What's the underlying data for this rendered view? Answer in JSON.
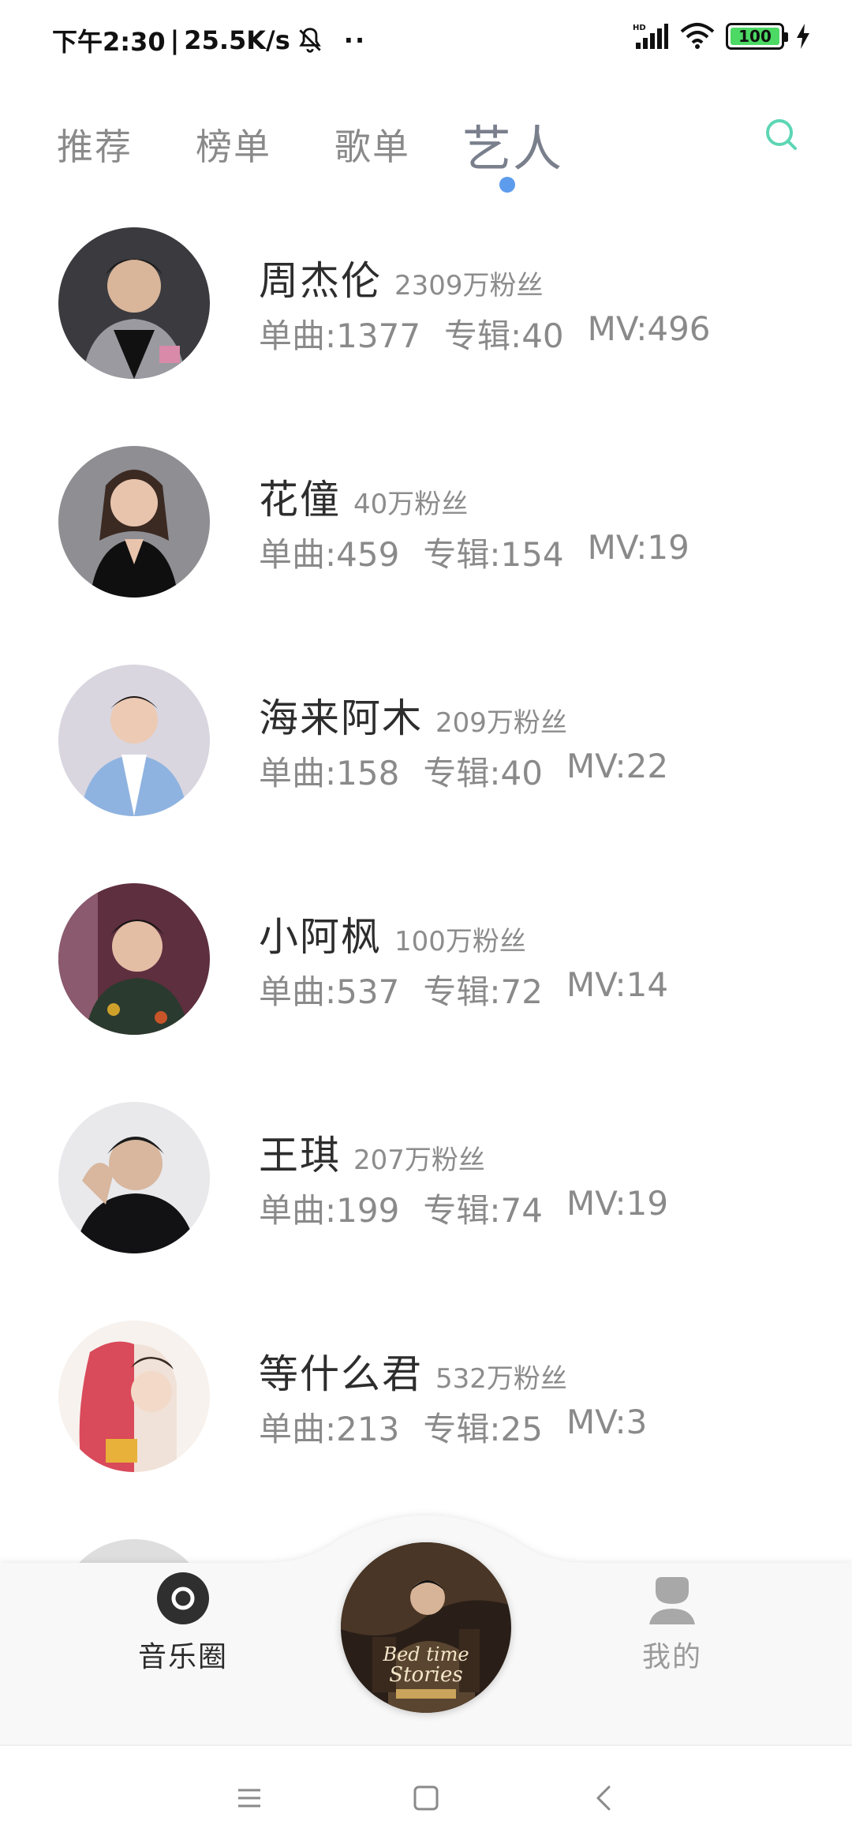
{
  "status_bar": {
    "time": "下午2:30",
    "network_speed": "25.5K/s",
    "separator": "|",
    "dots": "··",
    "hd_label": "HD",
    "battery_level": "100",
    "battery_color": "#4cd964"
  },
  "tabs": {
    "items": [
      {
        "label": "推荐"
      },
      {
        "label": "榜单"
      },
      {
        "label": "歌单"
      },
      {
        "label": "艺人"
      }
    ],
    "active_index": 3,
    "active_color": "#7a7f8c",
    "indicator_color": "#5d9cec",
    "search_icon": "search-icon",
    "search_color": "#5cd6b4"
  },
  "artists": [
    {
      "name": "周杰伦",
      "fans": "2309万粉丝",
      "songs": "单曲:1377",
      "albums": "专辑:40",
      "mvs": "MV:496"
    },
    {
      "name": "花僮",
      "fans": "40万粉丝",
      "songs": "单曲:459",
      "albums": "专辑:154",
      "mvs": "MV:19"
    },
    {
      "name": "海来阿木",
      "fans": "209万粉丝",
      "songs": "单曲:158",
      "albums": "专辑:40",
      "mvs": "MV:22"
    },
    {
      "name": "小阿枫",
      "fans": "100万粉丝",
      "songs": "单曲:537",
      "albums": "专辑:72",
      "mvs": "MV:14"
    },
    {
      "name": "王琪",
      "fans": "207万粉丝",
      "songs": "单曲:199",
      "albums": "专辑:74",
      "mvs": "MV:19"
    },
    {
      "name": "等什么君",
      "fans": "532万粉丝",
      "songs": "单曲:213",
      "albums": "专辑:25",
      "mvs": "MV:3"
    }
  ],
  "bottom_nav": {
    "left_label": "音乐圈",
    "right_label": "我的",
    "left_icon": "music-circle-icon",
    "right_icon": "user-icon",
    "center_icon": "now-playing-disc",
    "disc_text_line1": "Bed time",
    "disc_text_line2": "Stories"
  },
  "system_nav": {
    "menu_icon": "menu-icon",
    "home_icon": "home-icon",
    "back_icon": "back-icon"
  }
}
